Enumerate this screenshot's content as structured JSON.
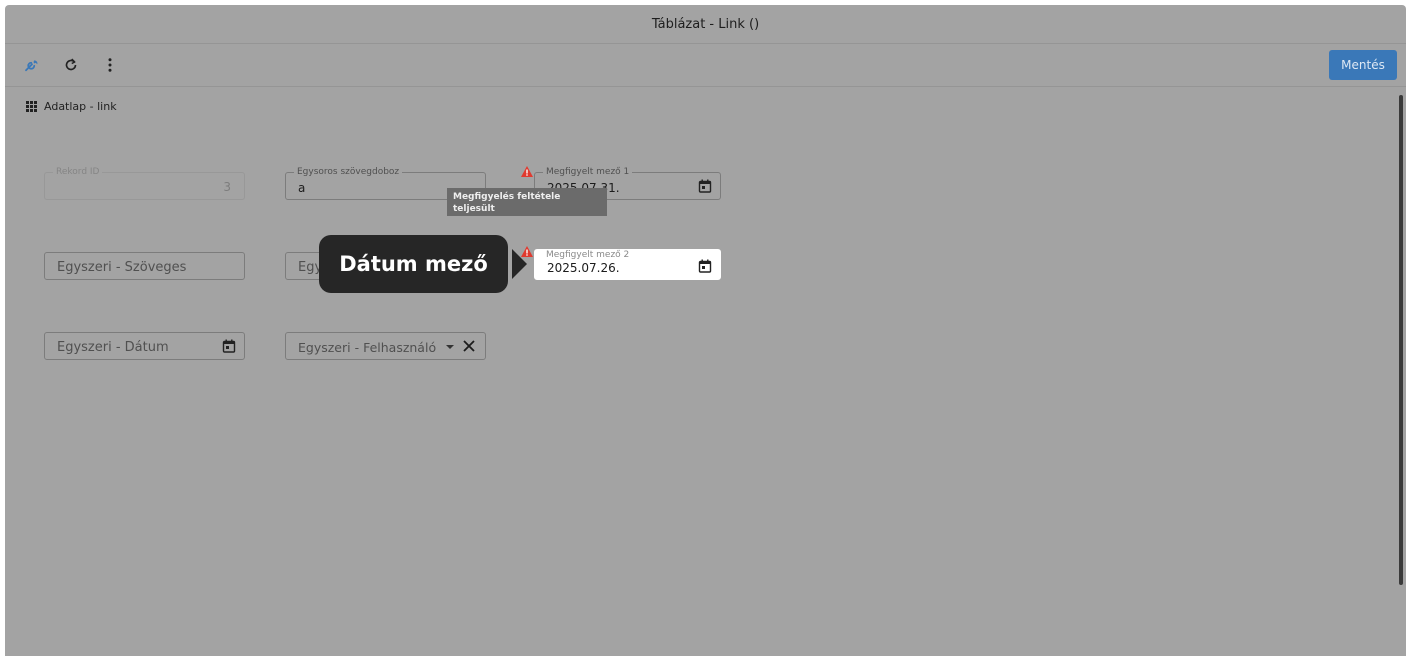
{
  "window": {
    "title": "Táblázat - Link ()"
  },
  "toolbar": {
    "icons": [
      "wrench-icon",
      "refresh-icon",
      "more-vertical-icon"
    ],
    "save_label": "Mentés",
    "accent_color": "#3a78b8"
  },
  "section": {
    "title": "Adatlap - link",
    "icon": "grid-icon"
  },
  "fields": {
    "record_id": {
      "label": "Rekord ID",
      "value": "3"
    },
    "single_line_text": {
      "label": "Egysoros szövegdoboz",
      "value": "a"
    },
    "watched_1": {
      "label": "Megfigyelt mező 1",
      "value": "2025.07.31."
    },
    "one_time_text": {
      "placeholder": "Egyszeri - Szöveges"
    },
    "hidden_field": {
      "placeholder": "Egy"
    },
    "watched_2": {
      "label": "Megfigyelt mező 2",
      "value": "2025.07.26."
    },
    "one_time_date": {
      "placeholder": "Egyszeri - Dátum"
    },
    "one_time_user": {
      "placeholder": "Egyszeri - Felhasználó"
    }
  },
  "tooltip": {
    "text": "Megfigyelés feltétele teljesült"
  },
  "callout": {
    "text": "Dátum mező"
  },
  "colors": {
    "warning": "#e03a2f",
    "overlay": "#a3a3a3",
    "callout_bg": "#262626"
  }
}
